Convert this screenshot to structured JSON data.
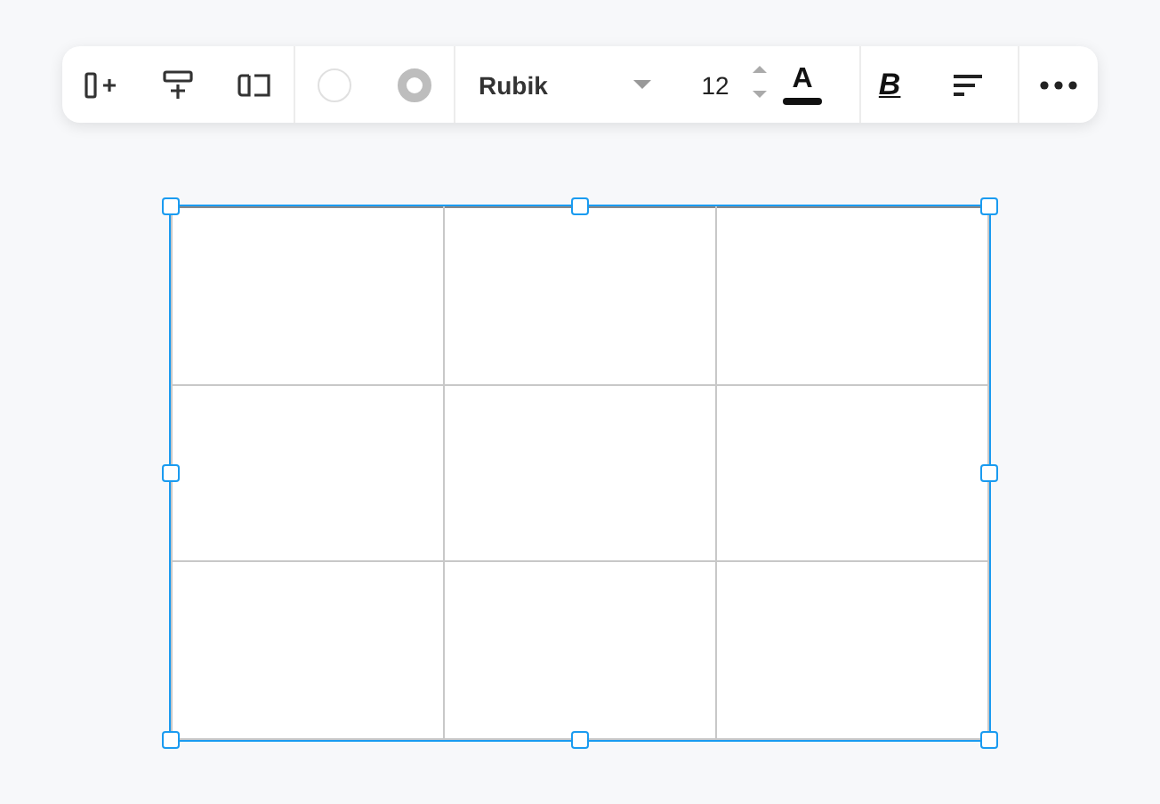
{
  "toolbar": {
    "font": {
      "family": "Rubik",
      "size": "12"
    },
    "text_color_label": "A",
    "bold_label": "B"
  },
  "table": {
    "selected": true,
    "rows": [
      {
        "cells": [
          {
            "kind": "empty"
          },
          {
            "kind": "empty"
          },
          {
            "kind": "empty"
          }
        ]
      },
      {
        "cells": [
          {
            "kind": "empty"
          },
          {
            "kind": "empty"
          },
          {
            "kind": "empty"
          }
        ]
      },
      {
        "cells": [
          {
            "kind": "empty"
          },
          {
            "kind": "empty"
          },
          {
            "kind": "empty"
          }
        ]
      }
    ]
  }
}
